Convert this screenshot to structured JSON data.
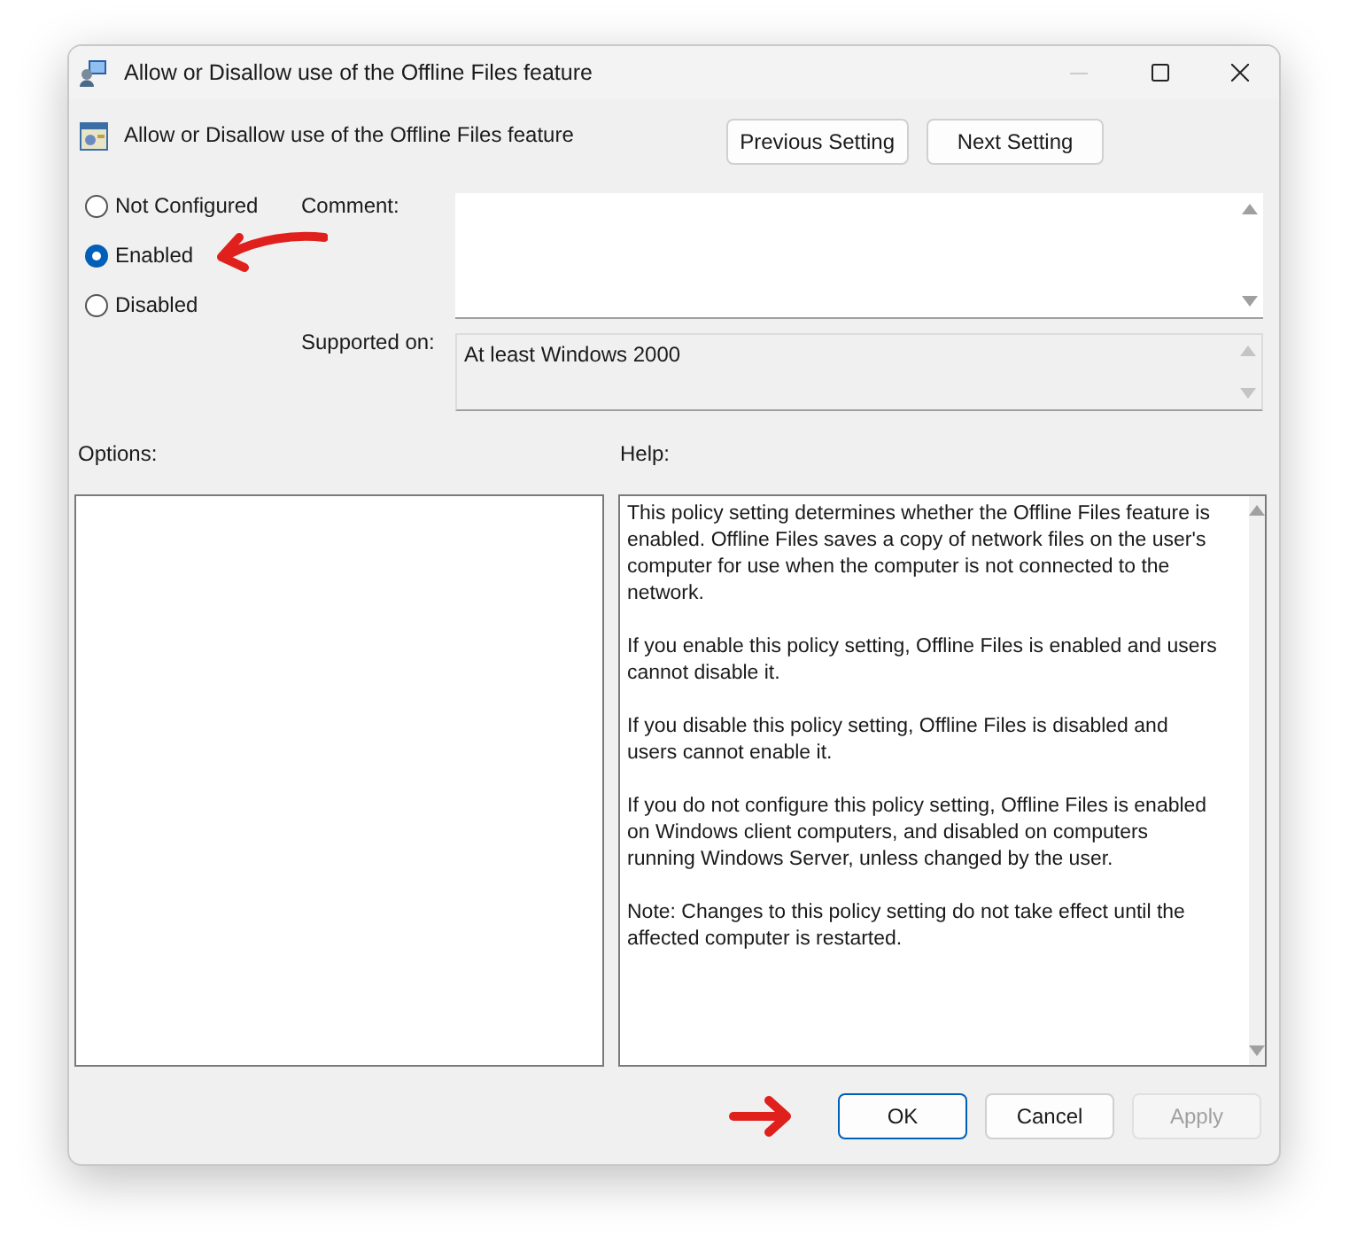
{
  "window": {
    "title": "Allow or Disallow use of the Offline Files feature"
  },
  "setting": {
    "title": "Allow or Disallow use of the Offline Files feature"
  },
  "nav_buttons": [
    "Previous Setting",
    "Next Setting"
  ],
  "states": [
    {
      "label": "Not Configured",
      "selected": false
    },
    {
      "label": "Enabled",
      "selected": true
    },
    {
      "label": "Disabled",
      "selected": false
    }
  ],
  "comment": {
    "label": "Comment:"
  },
  "supported_on": {
    "label": "Supported on:",
    "value": "At least Windows 2000"
  },
  "options": {
    "label": "Options:"
  },
  "help": {
    "label": "Help:",
    "paragraphs": [
      "This policy setting determines whether the Offline Files feature is enabled. Offline Files saves a copy of network files on the user's computer for use when the computer is not connected to the network.",
      "If you enable this policy setting, Offline Files is enabled and users cannot disable it.",
      "If you disable this policy setting, Offline Files is disabled and users cannot enable it.",
      "If you do not configure this policy setting, Offline Files is enabled on Windows client computers, and disabled on computers running Windows Server, unless changed by the user.",
      "Note: Changes to this policy setting do not take effect until the affected computer is restarted."
    ]
  },
  "buttons": [
    {
      "label": "OK",
      "kind": "default",
      "disabled": false
    },
    {
      "label": "Cancel",
      "kind": "normal",
      "disabled": false
    },
    {
      "label": "Apply",
      "kind": "normal",
      "disabled": true
    }
  ]
}
